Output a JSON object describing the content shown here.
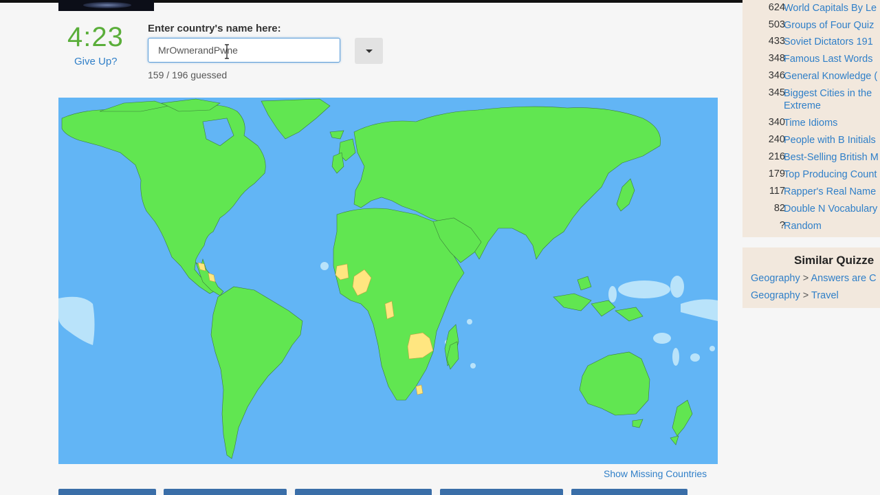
{
  "timer": {
    "time": "4:23",
    "give_up": "Give Up?"
  },
  "entry": {
    "label": "Enter country's name here:",
    "value": "MrOwnerandPwne",
    "dropdown_icon": "caret-down-icon",
    "guessed": "159 / 196 guessed"
  },
  "map": {
    "ocean_color": "#62b5f5",
    "guessed_color": "#61e651",
    "missing_color": "#ffe680",
    "show_missing": "Show Missing Countries"
  },
  "sidebar": {
    "items": [
      {
        "count": "624",
        "title": "World Capitals By Le"
      },
      {
        "count": "503",
        "title": "Groups of Four Quiz"
      },
      {
        "count": "433",
        "title": "Soviet Dictators 191"
      },
      {
        "count": "348",
        "title": "Famous Last Words"
      },
      {
        "count": "346",
        "title": "General Knowledge ("
      },
      {
        "count": "345",
        "title": "Biggest Cities in the",
        "title2": "Extreme"
      },
      {
        "count": "340",
        "title": "Time Idioms"
      },
      {
        "count": "240",
        "title": "People with B Initials"
      },
      {
        "count": "216",
        "title": "Best-Selling British M"
      },
      {
        "count": "179",
        "title": "Top Producing Count"
      },
      {
        "count": "117",
        "title": "Rapper's Real Name"
      },
      {
        "count": "82",
        "title": "Double N Vocabulary"
      },
      {
        "count": "?",
        "title": "Random"
      }
    ]
  },
  "similar": {
    "title": "Similar Quizze",
    "rows": [
      {
        "cat": "Geography",
        "sep": ">",
        "sub": "Answers are C"
      },
      {
        "cat": "Geography",
        "sep": ">",
        "sub": "Travel"
      }
    ]
  }
}
